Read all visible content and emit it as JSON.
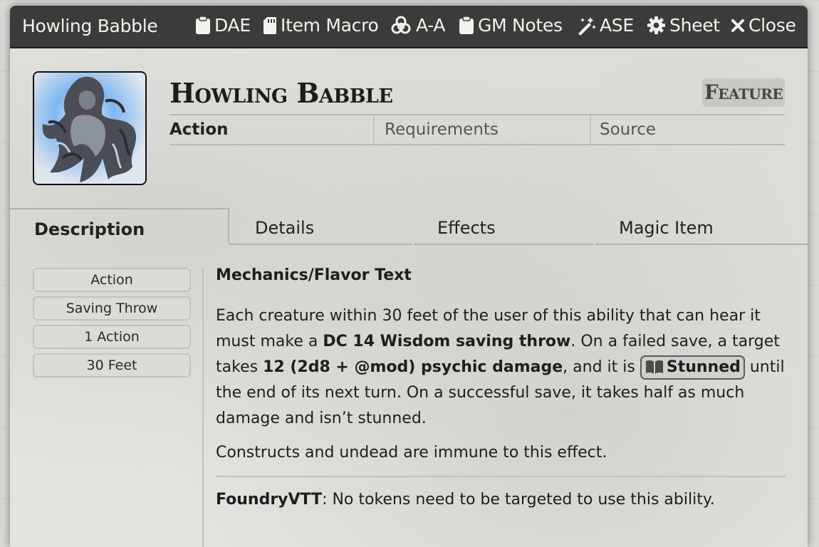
{
  "window": {
    "title": "Howling Babble",
    "header_buttons": [
      {
        "label": "DAE",
        "icon": "clipboard-icon"
      },
      {
        "label": "Item Macro",
        "icon": "sd-card-icon"
      },
      {
        "label": "A-A",
        "icon": "biohazard-icon"
      },
      {
        "label": "GM Notes",
        "icon": "clipboard-icon"
      },
      {
        "label": "ASE",
        "icon": "magic-wand-icon"
      },
      {
        "label": "Sheet",
        "icon": "gear-icon"
      },
      {
        "label": "Close",
        "icon": "close-icon"
      }
    ]
  },
  "item": {
    "name": "Howling Babble",
    "type": "Feature",
    "summary": {
      "activation": "Action",
      "requirements": "Requirements",
      "source": "Source"
    }
  },
  "tabs": [
    "Description",
    "Details",
    "Effects",
    "Magic Item"
  ],
  "properties": [
    "Action",
    "Saving Throw",
    "1 Action",
    "30 Feet"
  ],
  "description": {
    "heading": "Mechanics/Flavor Text",
    "p1_a": "Each creature within 30 feet of the user of this ability that can hear it must make a ",
    "p1_b": "DC 14 Wisdom saving throw",
    "p1_c": ". On a failed save, a target takes ",
    "p1_d": "12 (2d8 + @mod) psychic damage",
    "p1_e": ", and it is ",
    "p1_link": "Stunned",
    "p1_link_icon": "book-icon",
    "p1_f": " until the end of its next turn. On a successful save, it takes half as much damage and isn’t stunned.",
    "p2": "Constructs and undead are immune to this effect.",
    "p3_label": "FoundryVTT",
    "p3_text": ": No tokens need to be targeted to use this ability."
  }
}
